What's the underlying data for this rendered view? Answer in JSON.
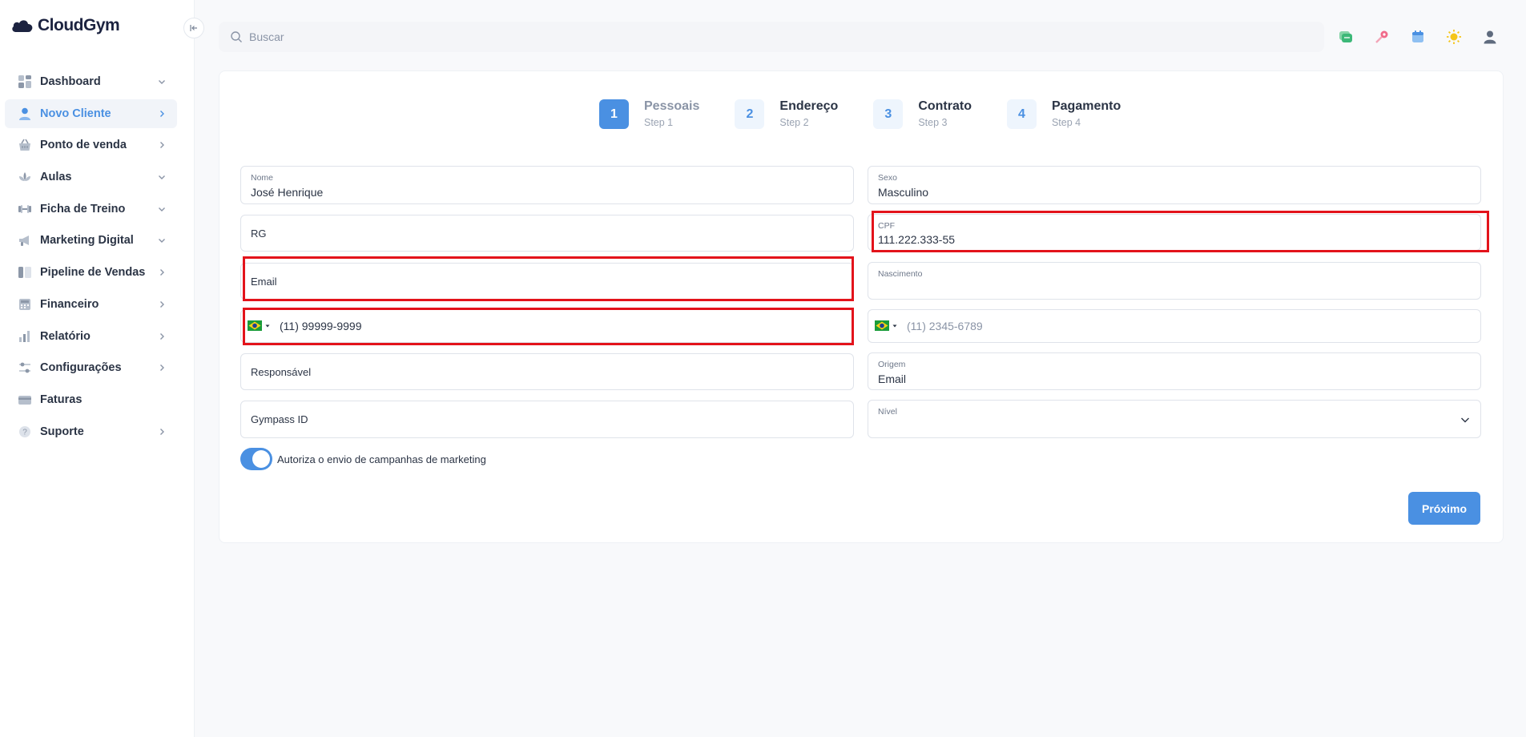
{
  "app": {
    "logo_text": "CloudGym"
  },
  "sidebar": {
    "items": [
      {
        "label": "Dashboard",
        "icon": "grid-icon",
        "chevron": "down"
      },
      {
        "label": "Novo Cliente",
        "icon": "user-icon",
        "chevron": "right",
        "active": true
      },
      {
        "label": "Ponto de venda",
        "icon": "basket-icon",
        "chevron": "right"
      },
      {
        "label": "Aulas",
        "icon": "lotus-icon",
        "chevron": "down"
      },
      {
        "label": "Ficha de Treino",
        "icon": "dumbbell-icon",
        "chevron": "down"
      },
      {
        "label": "Marketing Digital",
        "icon": "megaphone-icon",
        "chevron": "down"
      },
      {
        "label": "Pipeline de Vendas",
        "icon": "kanban-icon",
        "chevron": "right"
      },
      {
        "label": "Financeiro",
        "icon": "calculator-icon",
        "chevron": "right"
      },
      {
        "label": "Relatório",
        "icon": "bar-chart-icon",
        "chevron": "right"
      },
      {
        "label": "Configurações",
        "icon": "sliders-icon",
        "chevron": "right"
      },
      {
        "label": "Faturas",
        "icon": "card-icon",
        "chevron": "none"
      },
      {
        "label": "Suporte",
        "icon": "help-icon",
        "chevron": "right"
      }
    ]
  },
  "search": {
    "placeholder": "Buscar"
  },
  "stepper": [
    {
      "num": "1",
      "title": "Pessoais",
      "sub": "Step 1",
      "active": true
    },
    {
      "num": "2",
      "title": "Endereço",
      "sub": "Step 2"
    },
    {
      "num": "3",
      "title": "Contrato",
      "sub": "Step 3"
    },
    {
      "num": "4",
      "title": "Pagamento",
      "sub": "Step 4"
    }
  ],
  "form": {
    "nome": {
      "label": "Nome",
      "value": "José Henrique"
    },
    "sexo": {
      "label": "Sexo",
      "value": "Masculino"
    },
    "rg": {
      "label": "RG"
    },
    "cpf": {
      "label": "CPF",
      "value": "111.222.333-55"
    },
    "email": {
      "label": "Email"
    },
    "nascimento": {
      "label": "Nascimento"
    },
    "celular": {
      "value": "(11) 99999-9999"
    },
    "telefone": {
      "placeholder": "(11) 2345-6789"
    },
    "responsavel": {
      "label": "Responsável"
    },
    "origem": {
      "label": "Origem",
      "value": "Email"
    },
    "gympass": {
      "label": "Gympass ID"
    },
    "nivel": {
      "label": "Nível"
    },
    "marketing": {
      "label": "Autoriza o envio de campanhas de marketing",
      "on": true
    },
    "next_label": "Próximo"
  },
  "colors": {
    "accent": "#4a90e2",
    "highlight": "#e3131b"
  }
}
